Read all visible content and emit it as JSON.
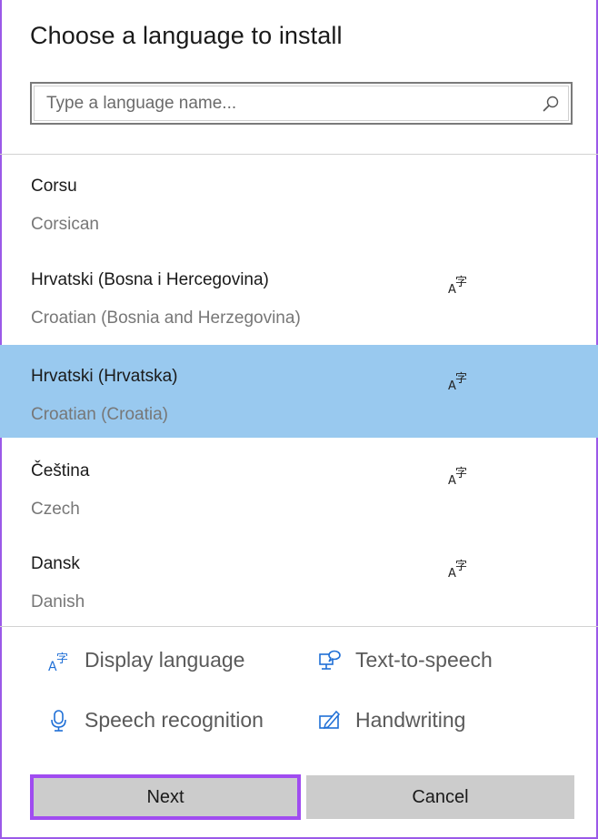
{
  "dialog": {
    "title": "Choose a language to install"
  },
  "search": {
    "placeholder": "Type a language name...",
    "value": ""
  },
  "languages": [
    {
      "native": "Corsu",
      "english": "Corsican",
      "display_language": false,
      "selected": false
    },
    {
      "native": "Hrvatski (Bosna i Hercegovina)",
      "english": "Croatian (Bosnia and Herzegovina)",
      "display_language": true,
      "selected": false
    },
    {
      "native": "Hrvatski (Hrvatska)",
      "english": "Croatian (Croatia)",
      "display_language": true,
      "selected": true
    },
    {
      "native": "Čeština",
      "english": "Czech",
      "display_language": true,
      "selected": false
    },
    {
      "native": "Dansk",
      "english": "Danish",
      "display_language": true,
      "selected": false
    }
  ],
  "features": {
    "display_language": "Display language",
    "text_to_speech": "Text-to-speech",
    "speech_recognition": "Speech recognition",
    "handwriting": "Handwriting"
  },
  "buttons": {
    "next": "Next",
    "cancel": "Cancel"
  },
  "colors": {
    "selected_row": "#99c9ef",
    "accent_icon": "#1f6fd6",
    "focus_outline": "#a04cf0",
    "button_bg": "#cccccc"
  }
}
